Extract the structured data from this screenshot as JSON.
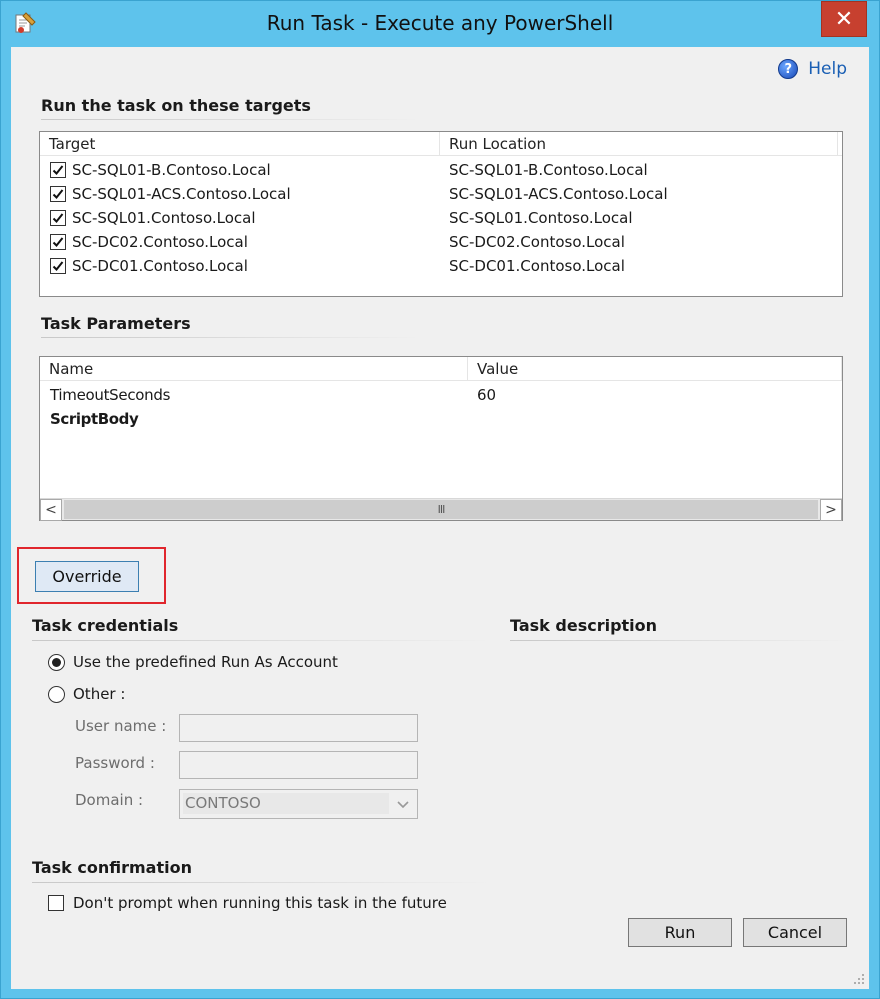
{
  "window": {
    "title": "Run Task - Execute any PowerShell",
    "close_glyph": "✕",
    "accent_color": "#5ec3ec"
  },
  "help": {
    "label": "Help",
    "icon": "help-icon",
    "glyph": "?"
  },
  "targets": {
    "section_title": "Run the task on these targets",
    "columns": [
      "Target",
      "Run Location"
    ],
    "rows": [
      {
        "checked": true,
        "target": "SC-SQL01-B.Contoso.Local",
        "run_location": "SC-SQL01-B.Contoso.Local"
      },
      {
        "checked": true,
        "target": "SC-SQL01-ACS.Contoso.Local",
        "run_location": "SC-SQL01-ACS.Contoso.Local"
      },
      {
        "checked": true,
        "target": "SC-SQL01.Contoso.Local",
        "run_location": "SC-SQL01.Contoso.Local"
      },
      {
        "checked": true,
        "target": "SC-DC02.Contoso.Local",
        "run_location": "SC-DC02.Contoso.Local"
      },
      {
        "checked": true,
        "target": "SC-DC01.Contoso.Local",
        "run_location": "SC-DC01.Contoso.Local"
      }
    ]
  },
  "parameters": {
    "section_title": "Task Parameters",
    "columns": [
      "Name",
      "Value"
    ],
    "rows": [
      {
        "name": "TimeoutSeconds",
        "value": "60",
        "bold": false
      },
      {
        "name": "ScriptBody",
        "value": "",
        "bold": true
      }
    ],
    "scroll_left": "<",
    "scroll_right": ">",
    "scroll_thumb": "III"
  },
  "override_button": "Override",
  "credentials": {
    "section_title": "Task credentials",
    "option_predefined": "Use the predefined Run As Account",
    "option_other": "Other :",
    "selected": "predefined",
    "user_name_label": "User name :",
    "password_label": "Password :",
    "domain_label": "Domain :",
    "domain_value": "CONTOSO"
  },
  "description": {
    "section_title": "Task description"
  },
  "confirmation": {
    "section_title": "Task confirmation",
    "dont_prompt_label": "Don't prompt when running this task in the future",
    "dont_prompt_checked": false
  },
  "footer": {
    "run_label": "Run",
    "cancel_label": "Cancel"
  }
}
